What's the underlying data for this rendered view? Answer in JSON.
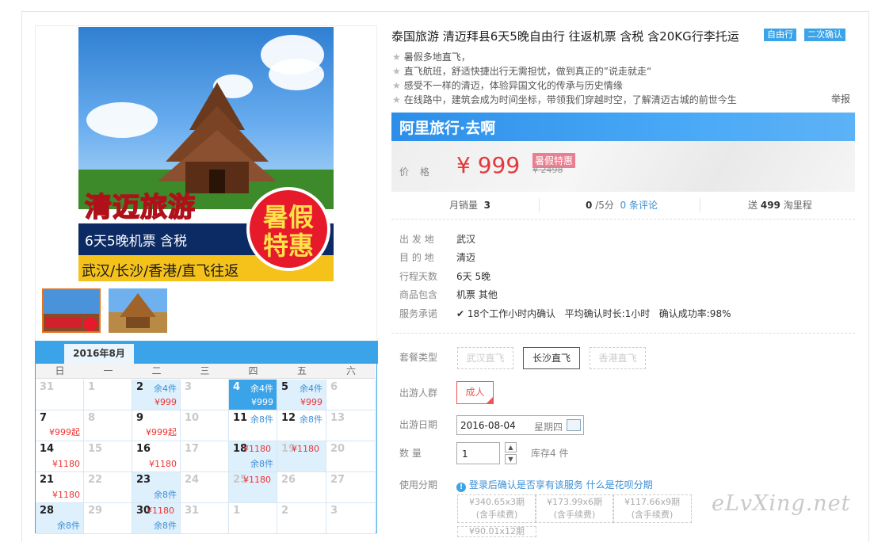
{
  "product": {
    "title": "泰国旅游 清迈拜县6天5晚自由行 往返机票 含税 含20KG行李托运",
    "tags": [
      "自由行",
      "二次确认"
    ],
    "features": [
      "暑假多地直飞，",
      "直飞航班，舒适快捷出行无需担忧，做到真正的”说走就走“",
      "感受不一样的清迈，体验异国文化的传承与历史情缘",
      "在线路中，建筑会成为时间坐标，带领我们穿越时空，了解清迈古城的前世今生"
    ],
    "report": "举报"
  },
  "banner": {
    "brand": "阿里旅行·去啊"
  },
  "price": {
    "label": "价格",
    "value": "¥ 999",
    "tag": "暑假特惠",
    "original": "¥ 2498"
  },
  "stats": {
    "sales_label": "月销量",
    "sales": "3",
    "rating": "0",
    "rating_suffix": "/5分",
    "reviews": "0 条评论",
    "gift_pre": "送",
    "gift_num": "499",
    "gift_post": "淘里程"
  },
  "details": [
    {
      "label": "出 发 地",
      "value": "武汉"
    },
    {
      "label": "目 的 地",
      "value": "清迈"
    },
    {
      "label": "行程天数",
      "value": "6天 5晚"
    },
    {
      "label": "商品包含",
      "value": "机票 其他"
    }
  ],
  "service": {
    "label": "服务承诺",
    "items": [
      "18个工作小时内确认",
      "平均确认时长:1小时",
      "确认成功率:98%"
    ]
  },
  "package": {
    "label": "套餐类型",
    "options": [
      {
        "text": "武汉直飞",
        "active": false
      },
      {
        "text": "长沙直飞",
        "active": true
      },
      {
        "text": "香港直飞",
        "active": false
      }
    ]
  },
  "travelers": {
    "label": "出游人群",
    "option": "成人"
  },
  "date": {
    "label": "出游日期",
    "value": "2016-08-04",
    "weekday": "星期四"
  },
  "quantity": {
    "label": "数 量",
    "value": "1",
    "stock": "库存4 件"
  },
  "installment": {
    "label": "使用分期",
    "note": "登录后确认是否享有该服务",
    "link": "什么是花呗分期",
    "plans": [
      {
        "amount": "¥340.65x3期",
        "fee": "(含手续费)"
      },
      {
        "amount": "¥173.99x6期",
        "fee": "(含手续费)"
      },
      {
        "amount": "¥117.66x9期",
        "fee": "(含手续费)"
      }
    ],
    "partial": "¥90.01x12期"
  },
  "image": {
    "title": "清迈旅游",
    "sub": "6天5晚机票 含税",
    "cities": "武汉/长沙/香港/直飞往返",
    "badge1": "暑假",
    "badge2": "特惠"
  },
  "calendar": {
    "month": "2016年8月",
    "weekdays": [
      "日",
      "一",
      "二",
      "三",
      "四",
      "五",
      "六"
    ],
    "cells": [
      {
        "d": "31",
        "g": true
      },
      {
        "d": "1",
        "g": true
      },
      {
        "d": "2",
        "s": "余4件",
        "p": "¥999",
        "on": true
      },
      {
        "d": "3",
        "g": true
      },
      {
        "d": "4",
        "s": "余4件",
        "p": "¥999",
        "sel": true
      },
      {
        "d": "5",
        "s": "余4件",
        "p": "¥999",
        "on": true
      },
      {
        "d": "6",
        "g": true
      },
      {
        "d": "7",
        "p": "¥999起"
      },
      {
        "d": "8",
        "g": true
      },
      {
        "d": "9",
        "p": "¥999起"
      },
      {
        "d": "10",
        "g": true
      },
      {
        "d": "11",
        "s": "余8件"
      },
      {
        "d": "12",
        "s": "余8件"
      },
      {
        "d": "13",
        "g": true
      },
      {
        "d": "14",
        "p": "¥1180"
      },
      {
        "d": "15",
        "g": true
      },
      {
        "d": "16",
        "p": "¥1180"
      },
      {
        "d": "17",
        "g": true
      },
      {
        "d": "18",
        "pm": "¥1180",
        "s2": "余8件",
        "on": true
      },
      {
        "d": "19",
        "g": true,
        "pm": "¥1180",
        "on": true
      },
      {
        "d": "20",
        "g": true
      },
      {
        "d": "21",
        "p": "¥1180"
      },
      {
        "d": "22",
        "g": true
      },
      {
        "d": "23",
        "s2": "余8件",
        "on": true
      },
      {
        "d": "24",
        "g": true
      },
      {
        "d": "25",
        "g": true,
        "pm": "¥1180",
        "on": true
      },
      {
        "d": "26",
        "g": true
      },
      {
        "d": "27",
        "g": true
      },
      {
        "d": "28",
        "s2": "余8件",
        "on": true
      },
      {
        "d": "29",
        "g": true
      },
      {
        "d": "30",
        "pm": "¥1180",
        "s2": "余8件",
        "on": true
      },
      {
        "d": "31",
        "g": true
      },
      {
        "d": "1",
        "g": true,
        "white": true
      },
      {
        "d": "2",
        "g": true,
        "white": true
      },
      {
        "d": "3",
        "g": true,
        "white": true
      }
    ]
  },
  "watermark": "eLvXing.net"
}
